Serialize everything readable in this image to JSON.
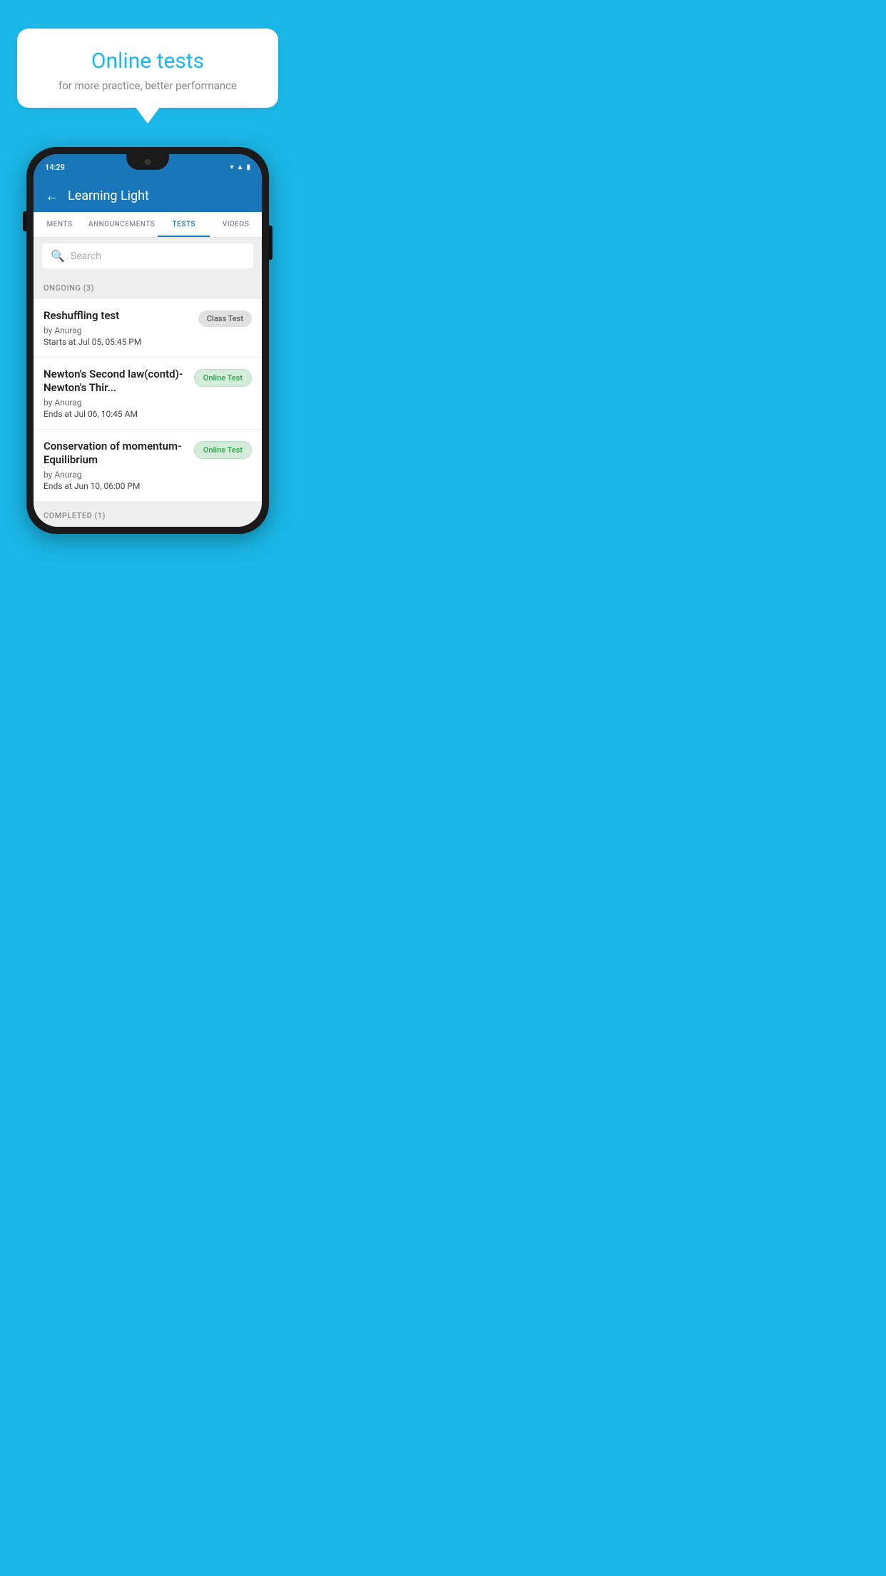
{
  "background": {
    "color": "#1AB8E8"
  },
  "speech_bubble": {
    "title": "Online tests",
    "subtitle": "for more practice, better performance"
  },
  "phone": {
    "status_bar": {
      "time": "14:29",
      "icons": [
        "wifi",
        "signal",
        "battery"
      ]
    },
    "app_header": {
      "title": "Learning Light",
      "back_label": "←"
    },
    "tabs": [
      {
        "label": "MENTS",
        "active": false
      },
      {
        "label": "ANNOUNCEMENTS",
        "active": false
      },
      {
        "label": "TESTS",
        "active": true
      },
      {
        "label": "VIDEOS",
        "active": false
      }
    ],
    "search": {
      "placeholder": "Search"
    },
    "ongoing_section": {
      "label": "ONGOING (3)"
    },
    "tests": [
      {
        "name": "Reshuffling test",
        "author": "by Anurag",
        "time_label": "Starts at",
        "time_value": "Jul 05, 05:45 PM",
        "badge": "Class Test",
        "badge_type": "class"
      },
      {
        "name": "Newton's Second law(contd)-Newton's Thir...",
        "author": "by Anurag",
        "time_label": "Ends at",
        "time_value": "Jul 06, 10:45 AM",
        "badge": "Online Test",
        "badge_type": "online"
      },
      {
        "name": "Conservation of momentum-Equilibrium",
        "author": "by Anurag",
        "time_label": "Ends at",
        "time_value": "Jun 10, 06:00 PM",
        "badge": "Online Test",
        "badge_type": "online"
      }
    ],
    "completed_section": {
      "label": "COMPLETED (1)"
    }
  }
}
